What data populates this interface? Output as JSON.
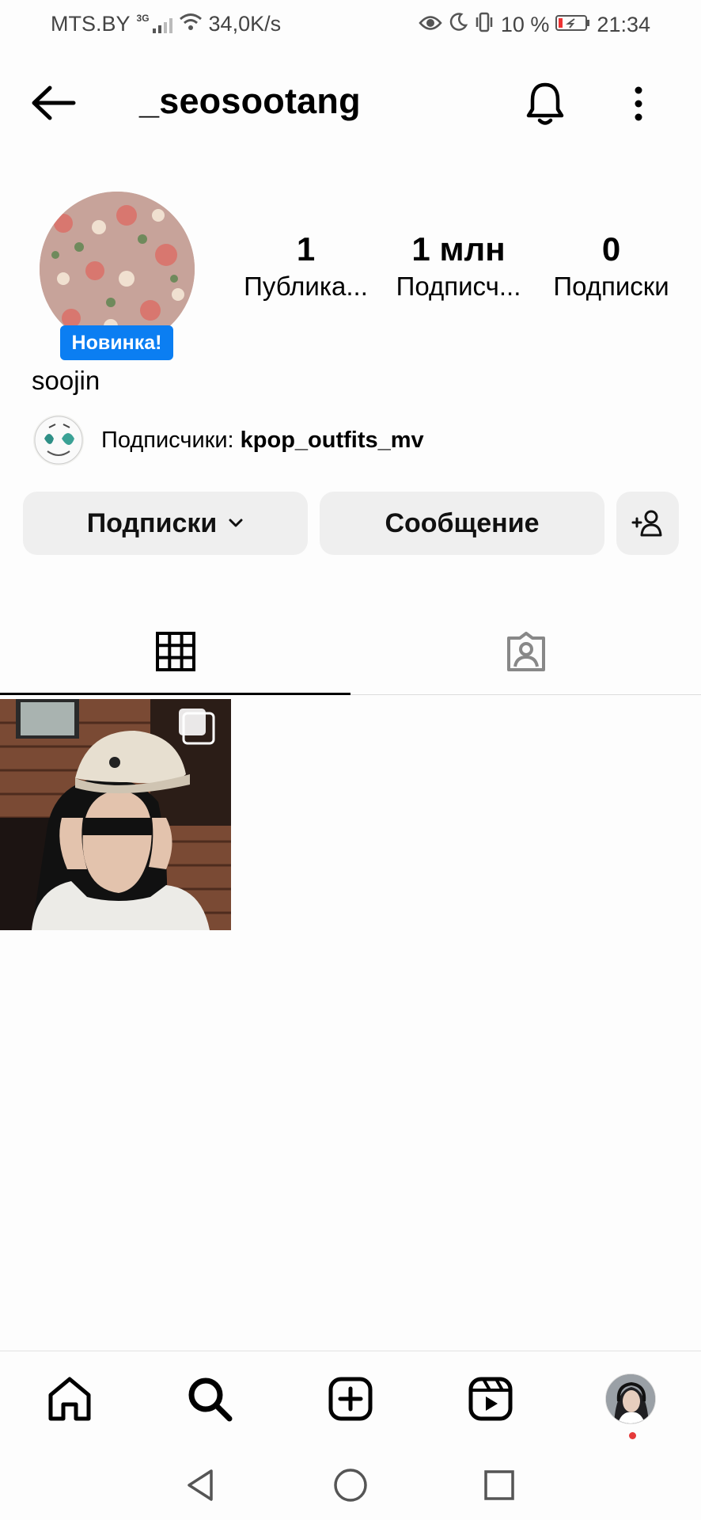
{
  "status_bar": {
    "carrier": "MTS.BY",
    "network_type": "3G",
    "speed": "34,0K/s",
    "battery": "10 %",
    "time": "21:34",
    "icons": [
      "signal-icon",
      "wifi-icon",
      "eye-icon",
      "moon-icon",
      "vibrate-icon",
      "battery-icon"
    ]
  },
  "header": {
    "username": "_seosootang",
    "icons": [
      "back-arrow-icon",
      "bell-icon",
      "more-vertical-icon"
    ]
  },
  "profile": {
    "new_badge": "Новинка!",
    "display_name": "soojin",
    "stats": [
      {
        "value": "1",
        "label": "Публика..."
      },
      {
        "value": "1 млн",
        "label": "Подписч..."
      },
      {
        "value": "0",
        "label": "Подписки"
      }
    ],
    "followed_by_prefix": "Подписчики: ",
    "followed_by_user": "kpop_outfits_mv"
  },
  "actions": {
    "following_label": "Подписки",
    "message_label": "Сообщение"
  },
  "tabs": [
    "grid-icon",
    "tagged-icon"
  ],
  "posts_count": 1,
  "bottom_nav": [
    "home-icon",
    "search-icon",
    "create-icon",
    "reels-icon",
    "profile-avatar"
  ],
  "colors": {
    "badge_blue": "#0b7ef2",
    "button_gray": "#efefef",
    "notification_dot": "#e53a3a"
  }
}
